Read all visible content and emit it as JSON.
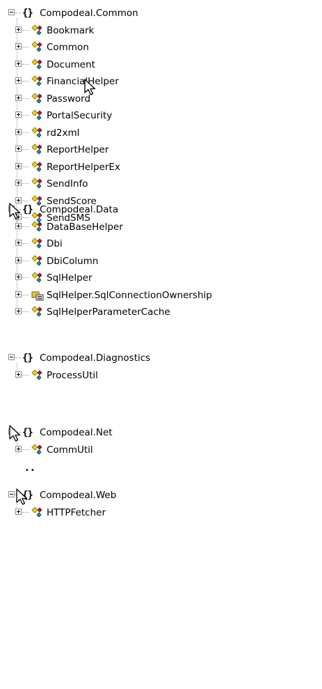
{
  "namespaces": [
    {
      "name": "Compodeal.Common",
      "expander": "minus",
      "classes": [
        "Bookmark",
        "Common",
        "Document",
        "FinancialHelper",
        "Password",
        "PortalSecurity",
        "rd2xml",
        "ReportHelper",
        "ReportHelperEx",
        "SendInfo",
        "SendScore",
        "SendSMS"
      ]
    },
    {
      "name": "Compodeal.Data",
      "expander": "minus",
      "classes": [
        "DataBaseHelper",
        "Dbi",
        "DbiColumn",
        "SqlHelper",
        "SqlHelper.SqlConnectionOwnership",
        "SqlHelperParameterCache"
      ]
    },
    {
      "name": "Compodeal.Diagnostics",
      "expander": "minus",
      "classes": [
        "ProcessUtil"
      ]
    },
    {
      "name": "Compodeal.Net",
      "expander": "minus",
      "classes": [
        "CommUtil"
      ]
    },
    {
      "name": "Compodeal.Web",
      "expander": "minus",
      "classes": [
        "HTTPFetcher"
      ]
    }
  ],
  "icons": {
    "namespace": "namespace-braces-icon",
    "class": "class-icon",
    "enum": "enum-icon",
    "cursor": "mouse-pointer-icon"
  },
  "colors": {
    "tree_line": "#9a9a9a",
    "class_icon_yellow": "#f2d200",
    "class_icon_magenta": "#9b1e6e",
    "class_icon_teal": "#1d8f8f",
    "enum_icon_yellow": "#e7c24a"
  }
}
